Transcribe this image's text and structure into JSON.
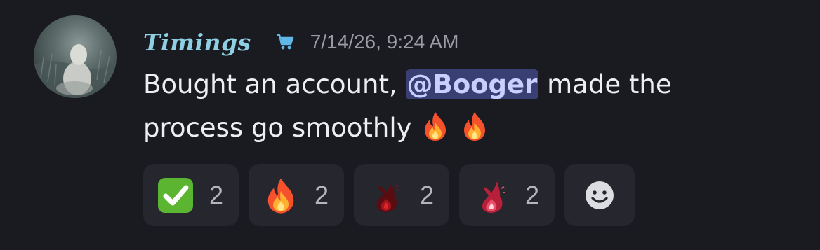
{
  "message": {
    "author": "Timings",
    "role_icon": "shopping-cart-icon",
    "timestamp": "7/14/26, 9:24 AM",
    "content": {
      "before_mention": "Bought an account, ",
      "mention": "@Booger",
      "after_mention": " made the process go smoothly",
      "trailing_emojis": [
        "fire",
        "fire"
      ]
    }
  },
  "reactions": [
    {
      "emoji": "white-check-mark",
      "count": "2"
    },
    {
      "emoji": "fire",
      "count": "2"
    },
    {
      "emoji": "dark-red-flame",
      "count": "2"
    },
    {
      "emoji": "pink-flame",
      "count": "2"
    }
  ],
  "add_reaction": {
    "icon": "smiley-add-reaction-icon"
  },
  "colors": {
    "background": "#1a1a21",
    "username": "#8fcfe3",
    "timestamp": "#9a9ba3",
    "text": "#eceef2",
    "mention_bg": "#3a3f73",
    "mention_text": "#c9d0ff",
    "reaction_bg": "#26262e"
  }
}
